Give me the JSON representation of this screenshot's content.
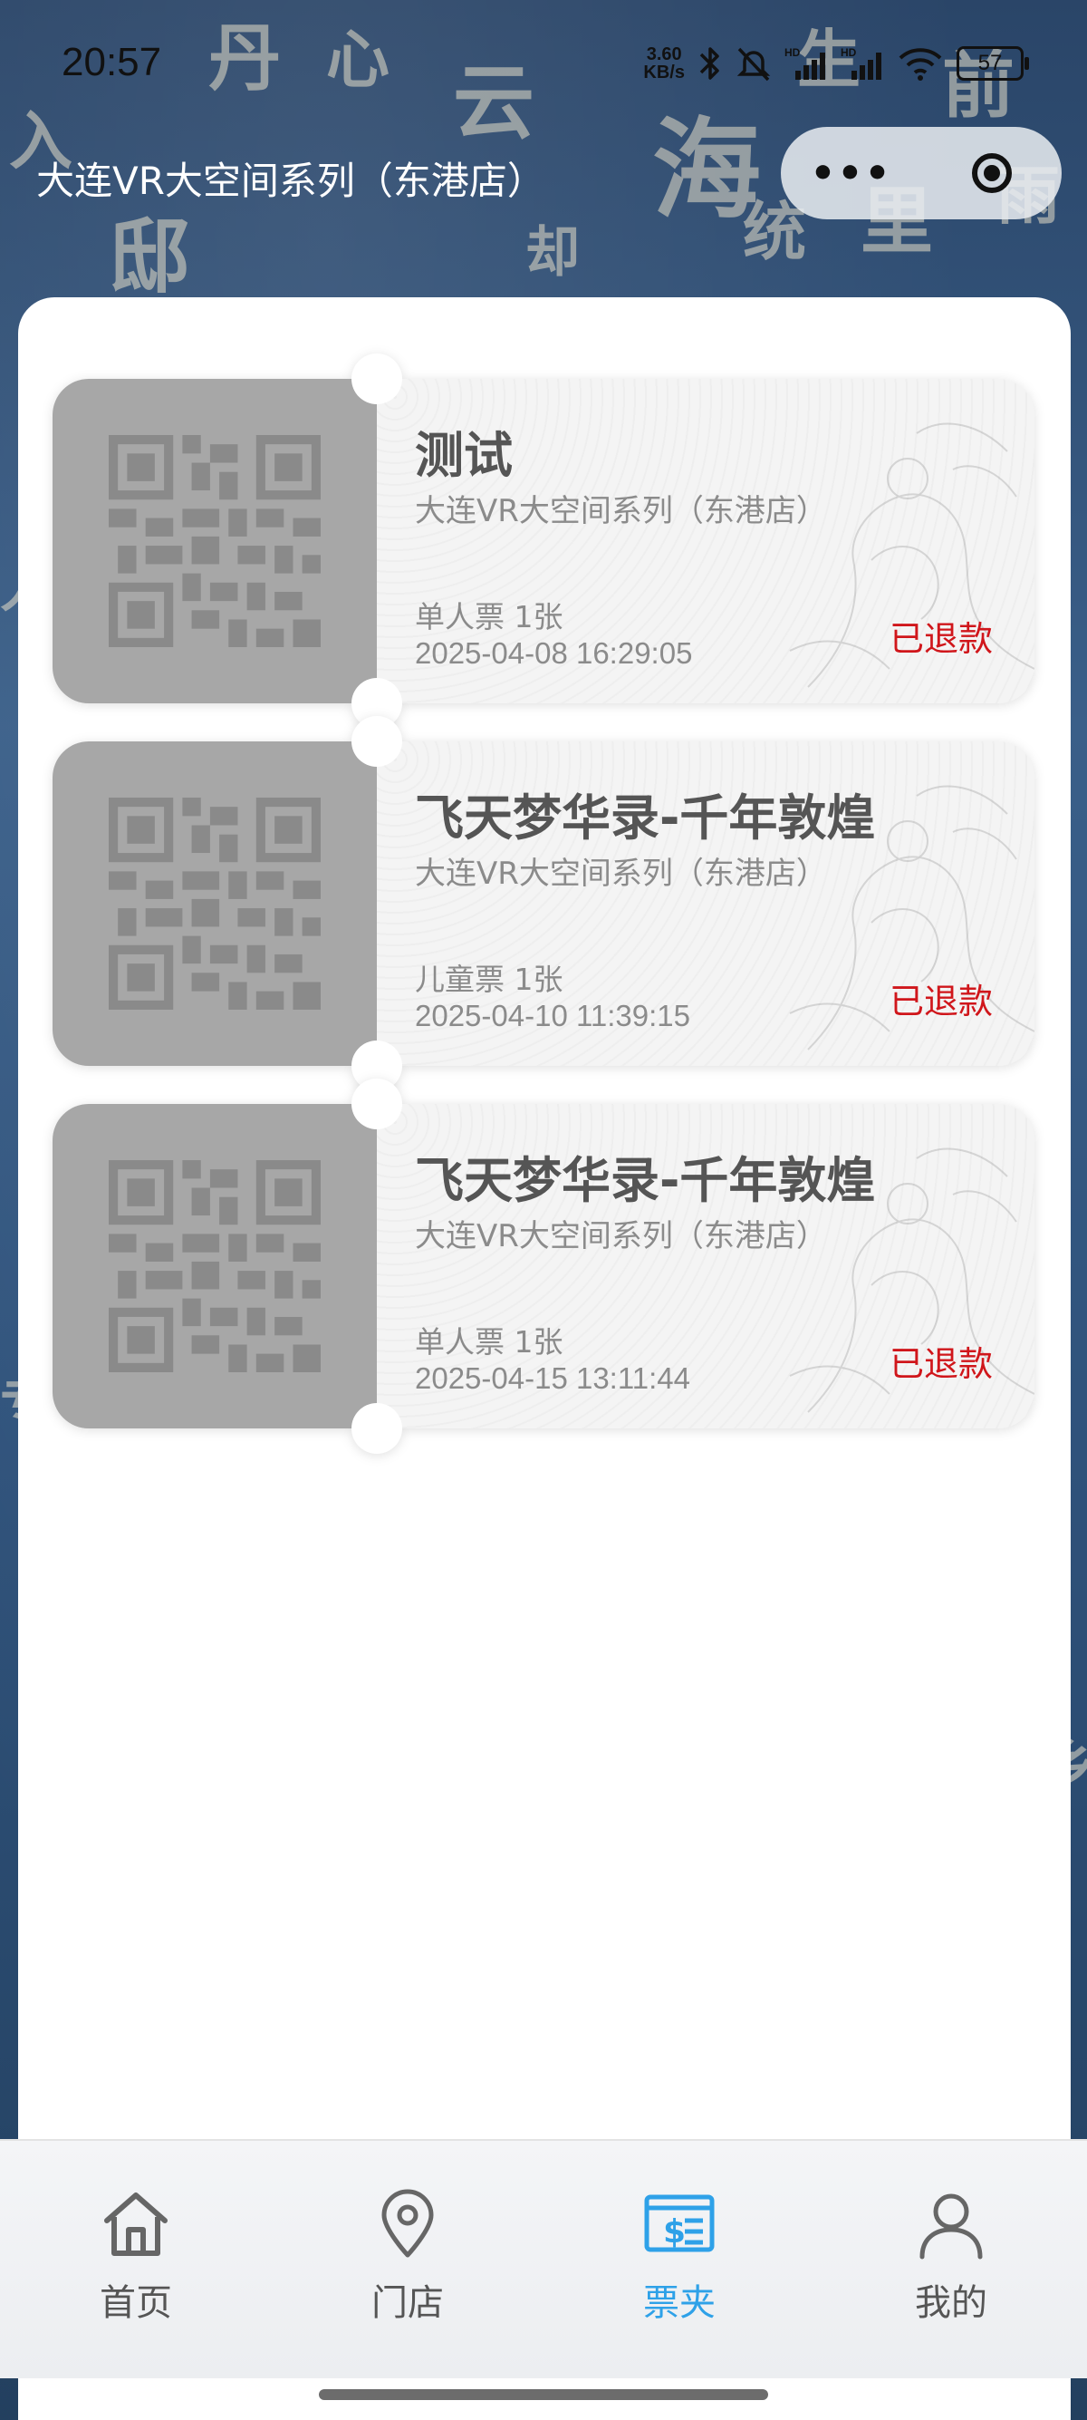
{
  "status_bar": {
    "time": "20:57",
    "net_speed_value": "3.60",
    "net_speed_unit": "KB/s",
    "battery": "57",
    "icons": [
      "bluetooth-icon",
      "mute-bell-icon",
      "signal-hd-icon",
      "signal-hd-icon",
      "wifi-icon",
      "battery-icon"
    ]
  },
  "header": {
    "title": "大连VR大空间系列（东港店）",
    "more_label": "•••"
  },
  "tickets": [
    {
      "name": "测试",
      "store": "大连VR大空间系列（东港店）",
      "type": "单人票 1张",
      "time": "2025-04-08 16:29:05",
      "status": "已退款"
    },
    {
      "name": "飞天梦华录-千年敦煌",
      "store": "大连VR大空间系列（东港店）",
      "type": "儿童票 1张",
      "time": "2025-04-10 11:39:15",
      "status": "已退款"
    },
    {
      "name": "飞天梦华录-千年敦煌",
      "store": "大连VR大空间系列（东港店）",
      "type": "单人票 1张",
      "time": "2025-04-15 13:11:44",
      "status": "已退款"
    }
  ],
  "tab_bar": {
    "items": [
      {
        "label": "首页",
        "icon": "home-icon",
        "active": false
      },
      {
        "label": "门店",
        "icon": "location-pin-icon",
        "active": false
      },
      {
        "label": "票夹",
        "icon": "ticket-icon",
        "active": true
      },
      {
        "label": "我的",
        "icon": "user-icon",
        "active": false
      }
    ]
  },
  "colors": {
    "accent": "#2ea1e8",
    "refund_status": "#d0161b",
    "stub_gray": "#a7a7a7"
  }
}
